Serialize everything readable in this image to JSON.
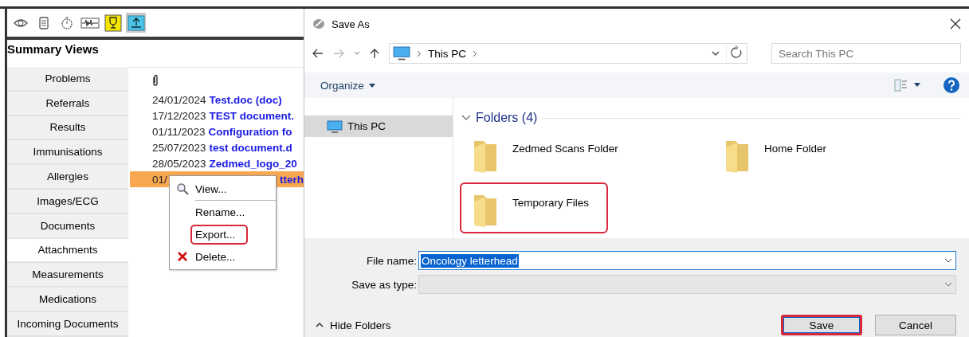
{
  "app": {
    "toolbar": [
      {
        "kind": "eye",
        "selected": false
      },
      {
        "kind": "notepad",
        "selected": false
      },
      {
        "kind": "stopwatch",
        "selected": false
      },
      {
        "kind": "waveform",
        "selected": false
      },
      {
        "kind": "trophy",
        "selected": false
      },
      {
        "kind": "upload",
        "selected": true
      }
    ],
    "panel_title": "Summary Views",
    "sidebar": {
      "items": [
        {
          "label": "Problems",
          "selected": false
        },
        {
          "label": "Referrals",
          "selected": false
        },
        {
          "label": "Results",
          "selected": false
        },
        {
          "label": "Immunisations",
          "selected": false
        },
        {
          "label": "Allergies",
          "selected": false
        },
        {
          "label": "Images/ECG",
          "selected": false
        },
        {
          "label": "Documents",
          "selected": false
        },
        {
          "label": "Attachments",
          "selected": true
        },
        {
          "label": "Measurements",
          "selected": false
        },
        {
          "label": "Medications",
          "selected": false
        },
        {
          "label": "Incoming Documents",
          "selected": false
        }
      ]
    },
    "attachments": {
      "rows": [
        {
          "date": "24/01/2024",
          "name": "Test.doc (doc)",
          "selected": false
        },
        {
          "date": "17/12/2023",
          "name": "TEST document.",
          "selected": false
        },
        {
          "date": "01/11/2023",
          "name": "Configuration fo",
          "selected": false
        },
        {
          "date": "25/07/2023",
          "name": "test document.d",
          "selected": false
        },
        {
          "date": "28/05/2023",
          "name": "Zedmed_logo_20",
          "selected": false
        },
        {
          "date": "01/",
          "name": "tterh",
          "selected": true
        }
      ]
    },
    "context_menu": {
      "items": [
        {
          "label": "View...",
          "kind": "view",
          "highlighted": false
        },
        {
          "label": "Rename...",
          "kind": "plain",
          "highlighted": false
        },
        {
          "label": "Export...",
          "kind": "plain",
          "highlighted": true
        },
        {
          "label": "Delete...",
          "kind": "delete",
          "highlighted": false
        }
      ]
    }
  },
  "dialog": {
    "title": "Save As",
    "address": {
      "crumbs": [
        "This PC"
      ]
    },
    "search": {
      "placeholder": "Search This PC"
    },
    "organize": "Organize",
    "nav_pane": [
      {
        "label": "This PC",
        "selected": true
      }
    ],
    "group": {
      "title": "Folders (4)",
      "expanded": true,
      "items": [
        {
          "name": "Zedmed Scans Folder",
          "highlighted": false
        },
        {
          "name": "Home Folder",
          "highlighted": false
        },
        {
          "name": "Temporary Files",
          "highlighted": true
        }
      ]
    },
    "file_name": {
      "label": "File name:",
      "value": "Oncology letterhead"
    },
    "save_type": {
      "label": "Save as type:"
    },
    "hide_folders": "Hide Folders",
    "buttons": [
      {
        "label": "Save",
        "kind": "primary",
        "highlighted": true
      },
      {
        "label": "Cancel",
        "kind": "normal",
        "highlighted": false
      }
    ]
  }
}
